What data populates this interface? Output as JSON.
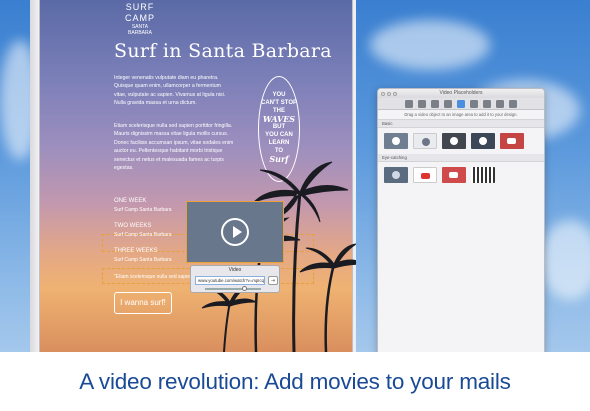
{
  "newsletter": {
    "logo_text": "SURF CAMP",
    "logo_sub": "SANTA BARBARA",
    "headline": "Surf in Santa Barbara",
    "paragraph_1": "Integer venenatis vulputate diam eu pharetra. Quisque quam enim, ullamcorper a fermentum vitae, vulputate ac sapien. Vivamus at ligula nisi. Nulla gravida massa et urna dictum.",
    "paragraph_2": "Etiam scelerisque nulla sed sapien porttitor fringilla. Mauris dignissim massa vitae ligula mollis cursus. Donec facilisis accumsan ipsum, vitae sodales enim auctor eu. Pellentesque habitant morbi tristique senectus et netus et malesuada fames ac turpis egestas.",
    "badge_lines": [
      "YOU",
      "CAN'T STOP",
      "THE",
      "WAVES",
      "BUT",
      "YOU CAN",
      "LEARN",
      "TO",
      "Surf"
    ],
    "weeks": [
      {
        "title": "ONE WEEK",
        "subtitle": "Surf Camp Santa Barbara"
      },
      {
        "title": "TWO WEEKS",
        "subtitle": "Surf Camp Santa Barbara"
      },
      {
        "title": "THREE WEEKS",
        "subtitle": "Surf Camp Santa Barbara"
      }
    ],
    "quote": "\"Etiam scelerisque nulla sed sapien porttitor fringilla\"",
    "cta_label": "I wanna surf!"
  },
  "video_popover": {
    "label": "Video",
    "url": "www.youtube.com/watch?v=mpIcqmIxkj4k",
    "button": "⇥",
    "slider_level": 0.7
  },
  "panel": {
    "title": "Video Placeholders",
    "hint": "Drag a video object to an image area to add it to your design.",
    "section_basic": "Basic",
    "section_eye": "Eye-catching",
    "basic_thumbs": [
      "#6f7e91",
      "#e9ebef",
      "#42474f",
      "#3b4657",
      "#c54444"
    ],
    "eye_thumbs": [
      "#5b6b80",
      "#ffffff",
      "#cf4a4a",
      "film"
    ],
    "accent": "#4a8ee0"
  },
  "banner": {
    "text": "A video revolution: Add movies to your mails",
    "color": "#1a4a96"
  }
}
